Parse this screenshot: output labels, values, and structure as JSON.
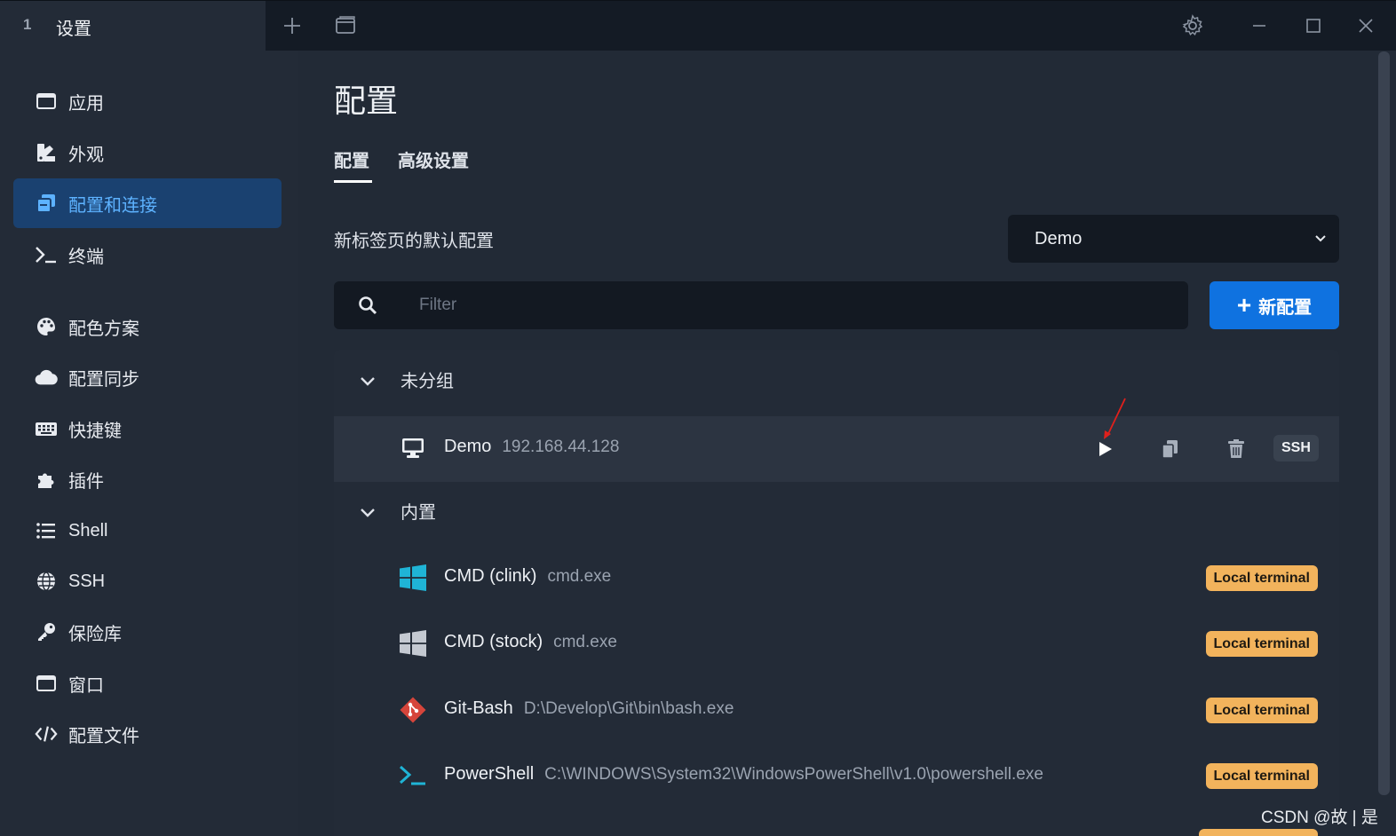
{
  "titlebar": {
    "tab_number": "1",
    "tab_title": "设置",
    "icons": [
      "plus-icon",
      "window-icon",
      "gear-icon",
      "minimize-icon",
      "maximize-icon",
      "close-icon"
    ]
  },
  "sidebar": {
    "items": [
      {
        "label": "应用",
        "icon": "app-window-icon"
      },
      {
        "label": "外观",
        "icon": "brush-icon"
      },
      {
        "label": "配置和连接",
        "icon": "profiles-icon",
        "active": true
      },
      {
        "label": "终端",
        "icon": "terminal-prompt-icon"
      },
      {
        "label": "配色方案",
        "icon": "palette-icon"
      },
      {
        "label": "配置同步",
        "icon": "cloud-icon"
      },
      {
        "label": "快捷键",
        "icon": "keyboard-icon"
      },
      {
        "label": "插件",
        "icon": "puzzle-icon"
      },
      {
        "label": "Shell",
        "icon": "list-icon"
      },
      {
        "label": "SSH",
        "icon": "globe-icon"
      },
      {
        "label": "保险库",
        "icon": "key-icon"
      },
      {
        "label": "窗口",
        "icon": "window-icon"
      },
      {
        "label": "配置文件",
        "icon": "code-icon"
      }
    ]
  },
  "main": {
    "title": "配置",
    "tabs": [
      {
        "label": "配置",
        "active": true
      },
      {
        "label": "高级设置"
      }
    ],
    "default_profile_label": "新标签页的默认配置",
    "default_profile_value": "Demo",
    "filter_placeholder": "Filter",
    "new_profile_button": "新配置",
    "groups": [
      {
        "label": "未分组",
        "rows": [
          {
            "name": "Demo",
            "desc": "192.168.44.128",
            "icon": "monitor-icon",
            "badge": "SSH",
            "actions": [
              "play-icon",
              "copy-icon",
              "trash-icon"
            ]
          }
        ]
      },
      {
        "label": "内置",
        "rows": [
          {
            "name": "CMD (clink)",
            "desc": "cmd.exe",
            "icon": "windows-color-icon",
            "badge": "Local terminal"
          },
          {
            "name": "CMD (stock)",
            "desc": "cmd.exe",
            "icon": "windows-gray-icon",
            "badge": "Local terminal"
          },
          {
            "name": "Git-Bash",
            "desc": "D:\\Develop\\Git\\bin\\bash.exe",
            "icon": "git-icon",
            "badge": "Local terminal"
          },
          {
            "name": "PowerShell",
            "desc": "C:\\WINDOWS\\System32\\WindowsPowerShell\\v1.0\\powershell.exe",
            "icon": "powershell-icon",
            "badge": "Local terminal"
          }
        ]
      }
    ]
  },
  "watermark": "CSDN @故 | 是",
  "colors": {
    "accent": "#0f72e0",
    "active_nav_bg": "#1a4170",
    "active_nav_text": "#5db2ff",
    "badge_local": "#f2b35c",
    "annotation_arrow": "#e0201c"
  }
}
